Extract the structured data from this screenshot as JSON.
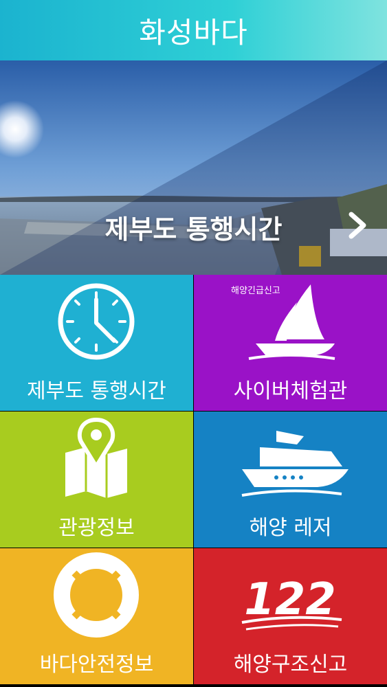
{
  "header": {
    "title": "화성바다"
  },
  "banner": {
    "title": "제부도 통행시간",
    "slides": 5,
    "active_slide": 1
  },
  "tiles": [
    {
      "label": "제부도 통행시간",
      "icon": "clock-icon",
      "color": "#1fb0d2"
    },
    {
      "label": "사이버체험관",
      "icon": "sailboat-icon",
      "color": "#9a12c7"
    },
    {
      "label": "관광정보",
      "icon": "map-pin-icon",
      "color": "#a8cc1f"
    },
    {
      "label": "해양 레저",
      "icon": "yacht-icon",
      "color": "#1582c4"
    },
    {
      "label": "바다안전정보",
      "icon": "lifebuoy-icon",
      "color": "#f0b424"
    },
    {
      "label": "해양구조신고",
      "icon": "emergency-122-icon",
      "color": "#d4232a"
    }
  ],
  "emergency": {
    "caption": "해양긴급신고",
    "number": "122"
  },
  "colors": {
    "accent": "#1bb3cf",
    "dot_active": "#f6c21b"
  }
}
